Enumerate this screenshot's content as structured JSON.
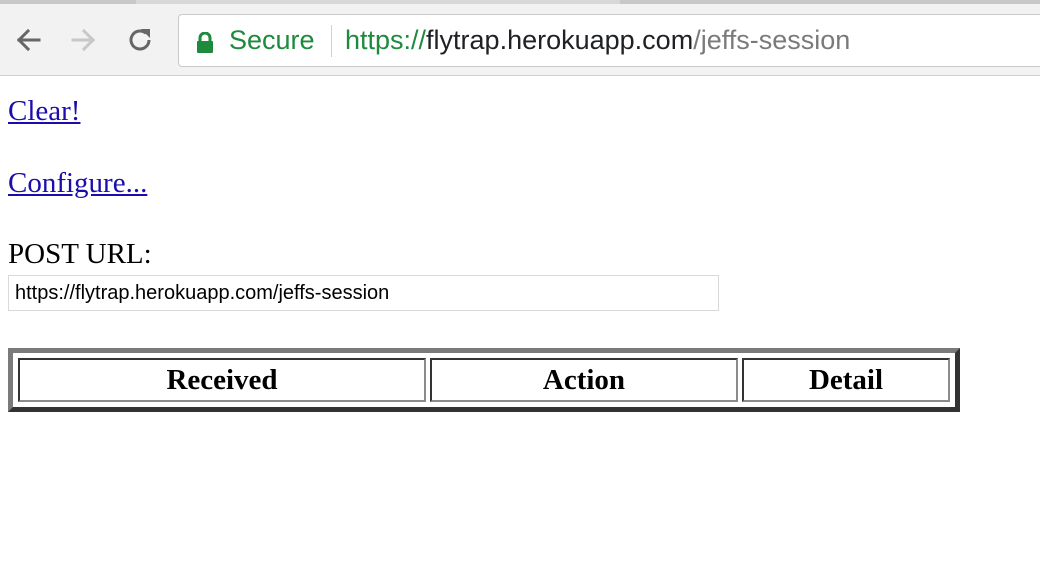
{
  "browser": {
    "security_label": "Secure",
    "url": {
      "scheme": "https://",
      "host": "flytrap.herokuapp.com",
      "path": "/jeffs-session"
    }
  },
  "page": {
    "clear_link": "Clear!",
    "configure_link": "Configure...",
    "post_url_label": "POST URL:",
    "post_url_value": "https://flytrap.herokuapp.com/jeffs-session",
    "table": {
      "headers": [
        "Received",
        "Action",
        "Detail"
      ]
    }
  },
  "colors": {
    "link": "#1a0dab",
    "secure_green": "#1e8a3e"
  }
}
